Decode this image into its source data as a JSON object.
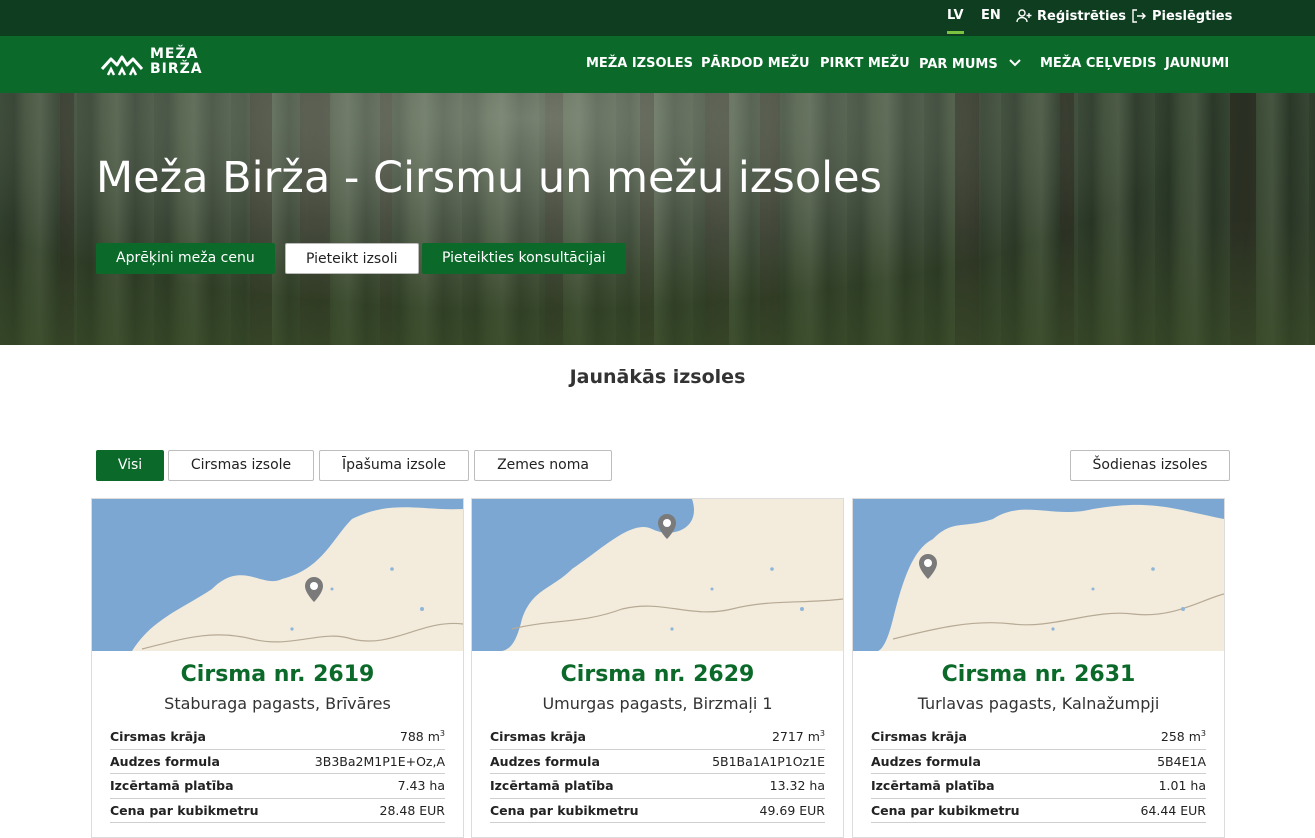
{
  "topbar": {
    "lang_lv": "LV",
    "lang_en": "EN",
    "register": "Reģistrēties",
    "login": "Pieslēgties"
  },
  "logo": {
    "line1": "MEŽA",
    "line2": "BIRŽA"
  },
  "nav": {
    "items": [
      "MEŽA IZSOLES",
      "PĀRDOD MEŽU",
      "PIRKT MEŽU",
      "PAR MUMS",
      "MEŽA CEĻVEDIS",
      "JAUNUMI"
    ]
  },
  "hero": {
    "title": "Meža Birža - Cirsmu un mežu izsoles",
    "buttons": [
      "Aprēķini meža cenu",
      "Pieteikt izsoli",
      "Pieteikties konsultācijai"
    ]
  },
  "section": {
    "title": "Jaunākās izsoles"
  },
  "filters": {
    "items": [
      "Visi",
      "Cirsmas izsole",
      "Īpašuma izsole",
      "Zemes noma"
    ],
    "today": "Šodienas izsoles"
  },
  "colors": {
    "brand": "#0b6a2a",
    "dark": "#0e3d1f",
    "accent": "#7cc242"
  },
  "cards": [
    {
      "title": "Cirsma nr. 2619",
      "location": "Staburaga pagasts, Brīvāres",
      "rows": [
        {
          "label": "Cirsmas krāja",
          "value": "788 m",
          "sup": "3"
        },
        {
          "label": "Audzes formula",
          "value": "3B3Ba2M1P1E+Oz,A"
        },
        {
          "label": "Izcērtamā platība",
          "value": "7.43 ha"
        },
        {
          "label": "Cena par kubikmetru",
          "value": "28.48 EUR"
        }
      ]
    },
    {
      "title": "Cirsma nr. 2629",
      "location": "Umurgas pagasts, Birzmaļi 1",
      "rows": [
        {
          "label": "Cirsmas krāja",
          "value": "2717 m",
          "sup": "3"
        },
        {
          "label": "Audzes formula",
          "value": "5B1Ba1A1P1Oz1E"
        },
        {
          "label": "Izcērtamā platība",
          "value": "13.32 ha"
        },
        {
          "label": "Cena par kubikmetru",
          "value": "49.69 EUR"
        }
      ]
    },
    {
      "title": "Cirsma nr. 2631",
      "location": "Turlavas pagasts, Kalnažumpji",
      "rows": [
        {
          "label": "Cirsmas krāja",
          "value": "258 m",
          "sup": "3"
        },
        {
          "label": "Audzes formula",
          "value": "5B4E1A"
        },
        {
          "label": "Izcērtamā platība",
          "value": "1.01 ha"
        },
        {
          "label": "Cena par kubikmetru",
          "value": "64.44 EUR"
        }
      ]
    }
  ]
}
